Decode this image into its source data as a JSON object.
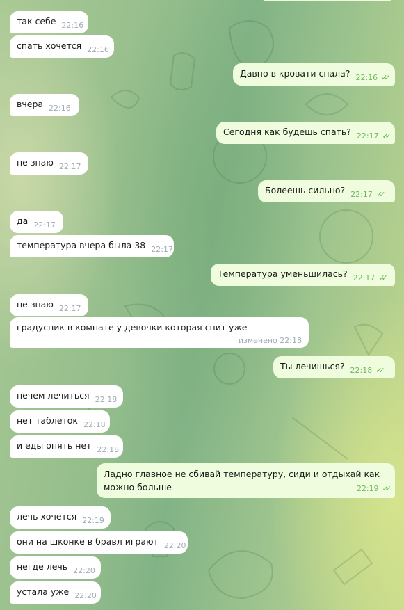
{
  "messages": [
    {
      "text": "так себе",
      "time": "22:16",
      "dir": "in"
    },
    {
      "text": "спать хочется",
      "time": "22:16",
      "dir": "in"
    },
    {
      "text": "Давно в кровати спала?",
      "time": "22:16",
      "dir": "out"
    },
    {
      "text": "вчера",
      "time": "22:16",
      "dir": "in"
    },
    {
      "text": "Сегодня как будешь спать?",
      "time": "22:17",
      "dir": "out"
    },
    {
      "text": "не знаю",
      "time": "22:17",
      "dir": "in"
    },
    {
      "text": "Болеешь сильно?",
      "time": "22:17",
      "dir": "out"
    },
    {
      "text": "да",
      "time": "22:17",
      "dir": "in"
    },
    {
      "text": "температура вчера была 38",
      "time": "22:17",
      "dir": "in"
    },
    {
      "text": "Температура уменьшилась?",
      "time": "22:17",
      "dir": "out"
    },
    {
      "text": "не знаю",
      "time": "22:17",
      "dir": "in"
    },
    {
      "text": "градусник в комнате у девочки которая спит уже",
      "time": "изменено 22:18",
      "dir": "in"
    },
    {
      "text": "Ты лечишься?",
      "time": "22:18",
      "dir": "out"
    },
    {
      "text": "нечем лечиться",
      "time": "22:18",
      "dir": "in"
    },
    {
      "text": "нет таблеток",
      "time": "22:18",
      "dir": "in"
    },
    {
      "text": "и еды опять нет",
      "time": "22:18",
      "dir": "in"
    },
    {
      "text": "Ладно главное не сбивай температуру, сиди и отдыхай как можно больше",
      "time": "22:19",
      "dir": "out"
    },
    {
      "text": "лечь хочется",
      "time": "22:19",
      "dir": "in"
    },
    {
      "text": "они на шконке в бравл играют",
      "time": "22:20",
      "dir": "in"
    },
    {
      "text": "негде лечь",
      "time": "22:20",
      "dir": "in"
    },
    {
      "text": "устала уже",
      "time": "22:20",
      "dir": "in"
    }
  ],
  "read_receipt": "✓✓",
  "colors": {
    "incoming": "#ffffff",
    "outgoing": "#effdde",
    "check": "#5fb24e"
  }
}
